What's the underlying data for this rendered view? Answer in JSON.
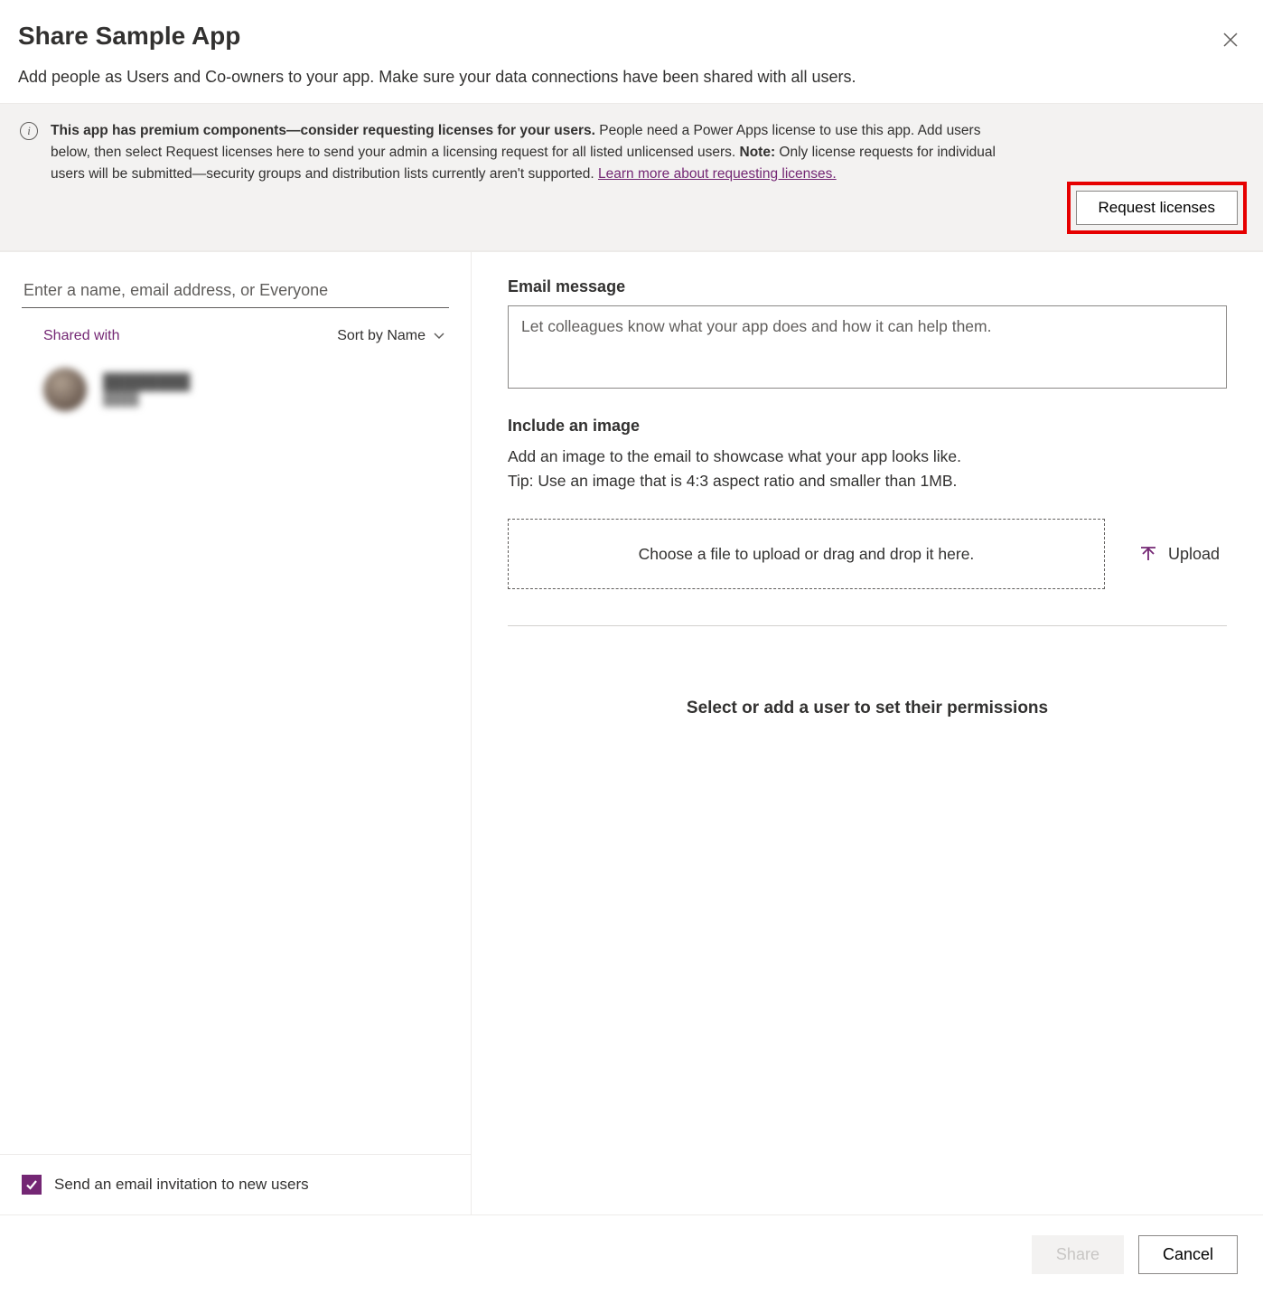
{
  "header": {
    "title": "Share Sample App",
    "subtitle": "Add people as Users and Co-owners to your app. Make sure your data connections have been shared with all users."
  },
  "banner": {
    "bold_intro": "This app has premium components—consider requesting licenses for your users.",
    "text_after_intro": " People need a Power Apps license to use this app. Add users below, then select Request licenses here to send your admin a licensing request for all listed unlicensed users. ",
    "note_label": "Note:",
    "note_text": " Only license requests for individual users will be submitted—security groups and distribution lists currently aren't supported. ",
    "learn_more": "Learn more about requesting licenses.",
    "request_button": "Request licenses"
  },
  "left": {
    "search_placeholder": "Enter a name, email address, or Everyone",
    "shared_with_label": "Shared with",
    "sort_label": "Sort by Name",
    "user": {
      "name": "████████",
      "role": "████"
    },
    "email_invite_label": "Send an email invitation to new users"
  },
  "right": {
    "email_label": "Email message",
    "email_placeholder": "Let colleagues know what your app does and how it can help them.",
    "include_image_label": "Include an image",
    "include_image_help1": "Add an image to the email to showcase what your app looks like.",
    "include_image_help2": "Tip: Use an image that is 4:3 aspect ratio and smaller than 1MB.",
    "dropzone_text": "Choose a file to upload or drag and drop it here.",
    "upload_label": "Upload",
    "permissions_prompt": "Select or add a user to set their permissions"
  },
  "footer": {
    "share": "Share",
    "cancel": "Cancel"
  }
}
